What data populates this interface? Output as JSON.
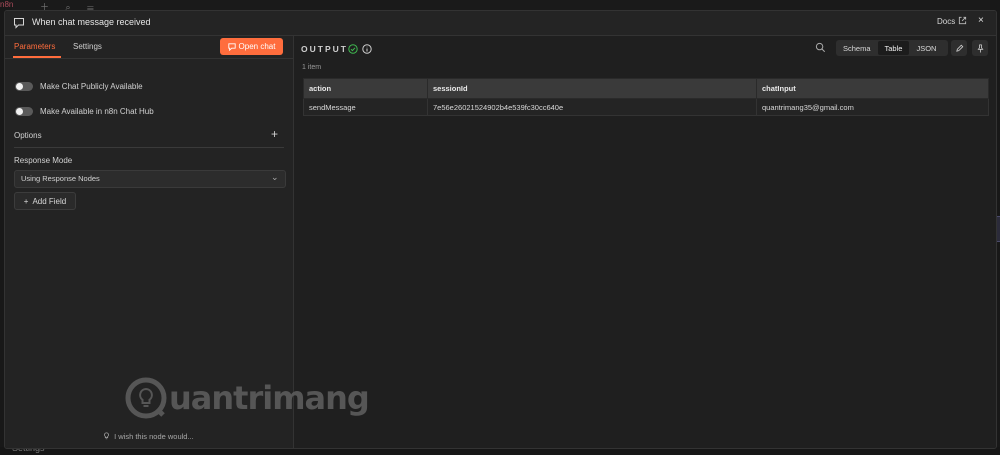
{
  "backdrop": {
    "corner_text": "n8n",
    "bottom_left_text": "Settings",
    "bottom_mid_text": "– – – – –"
  },
  "header": {
    "title": "When chat message received",
    "docs_label": "Docs",
    "close_label": "×"
  },
  "left_panel": {
    "tabs": [
      {
        "label": "Parameters",
        "active": true
      },
      {
        "label": "Settings",
        "active": false
      }
    ],
    "open_chat_label": "Open chat",
    "toggles": [
      {
        "label": "Make Chat Publicly Available",
        "on": false
      },
      {
        "label": "Make Available in n8n Chat Hub",
        "on": false
      }
    ],
    "options_label": "Options",
    "response_mode": {
      "label": "Response Mode",
      "value": "Using Response Nodes"
    },
    "add_field_label": "Add Field",
    "feedback_text": "I wish this node would..."
  },
  "output": {
    "label": "OUTPUT",
    "item_count": "1 item",
    "view_options": [
      "Schema",
      "Table",
      "JSON"
    ],
    "active_view": "Table",
    "columns": [
      "action",
      "sessionId",
      "chatInput"
    ],
    "rows": [
      [
        "sendMessage",
        "7e56e26021524902b4e539fc30cc640e",
        "quantrimang35@gmail.com"
      ]
    ]
  },
  "watermark": {
    "text": "uantrimang"
  },
  "colors": {
    "accent": "#ff6d3d",
    "panel": "#232323",
    "background": "#1f1f1f",
    "success": "#3fb950"
  }
}
